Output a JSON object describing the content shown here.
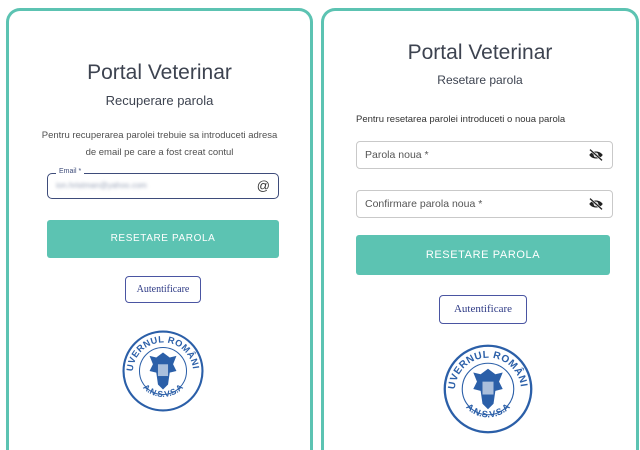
{
  "left_panel": {
    "title": "Portal Veterinar",
    "subtitle": "Recuperare parola",
    "description": "Pentru recuperarea parolei trebuie sa introduceti adresa de email pe care a fost creat contul",
    "email": {
      "label": "Email *",
      "value": "ion.hristman@yahoo.com",
      "icon": "at-icon"
    },
    "reset_button": "RESETARE PAROLA",
    "auth_button": "Autentificare",
    "seal": {
      "top_text": "GUVERNUL ROMÂNIEI",
      "bottom_text": "A.N.S.V.S.A"
    }
  },
  "right_panel": {
    "title": "Portal Veterinar",
    "subtitle": "Resetare parola",
    "description": "Pentru resetarea parolei introduceti o noua parola",
    "password_field": {
      "placeholder": "Parola noua *",
      "icon": "eye-off-icon"
    },
    "confirm_field": {
      "placeholder": "Confirmare parola noua *",
      "icon": "eye-off-icon"
    },
    "reset_button": "RESETARE PAROLA",
    "auth_button": "Autentificare",
    "seal": {
      "top_text": "GUVERNUL ROMÂNIEI",
      "bottom_text": "A.N.S.V.S.A"
    }
  },
  "colors": {
    "accent": "#5cc3b2",
    "link_blue": "#2f3b86",
    "seal_blue": "#2b5fa8"
  }
}
